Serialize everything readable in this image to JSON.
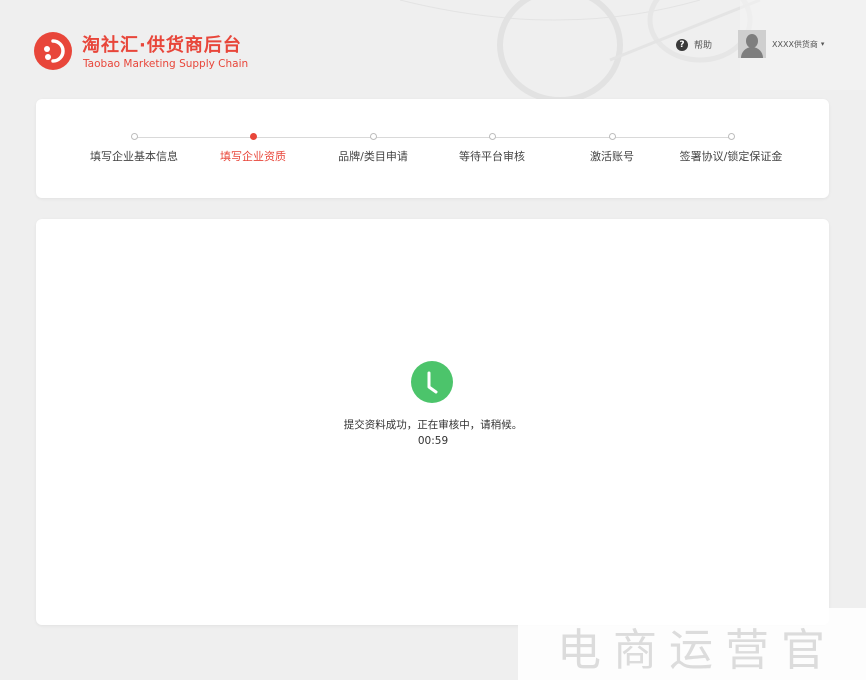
{
  "header": {
    "brand_title": "淘社汇·供货商后台",
    "brand_subtitle": "Taobao Marketing Supply Chain",
    "help_label": "帮助",
    "help_icon": "question-icon",
    "user_name": "XXXX供货商",
    "user_caret": "▾"
  },
  "steps": [
    {
      "label": "填写企业基本信息",
      "state": "done"
    },
    {
      "label": "填写企业资质",
      "state": "active"
    },
    {
      "label": "品牌/类目申请",
      "state": "pending"
    },
    {
      "label": "等待平台审核",
      "state": "pending"
    },
    {
      "label": "激活账号",
      "state": "pending"
    },
    {
      "label": "签署协议/锁定保证金",
      "state": "pending"
    }
  ],
  "main": {
    "status_icon": "clock-icon",
    "status_message": "提交资料成功，正在审核中，请稍候。",
    "countdown": "00:59"
  },
  "watermark": "电商运营官",
  "colors": {
    "brand_red": "#e8463a",
    "success_green": "#4cc46b",
    "page_bg": "#efefef"
  }
}
